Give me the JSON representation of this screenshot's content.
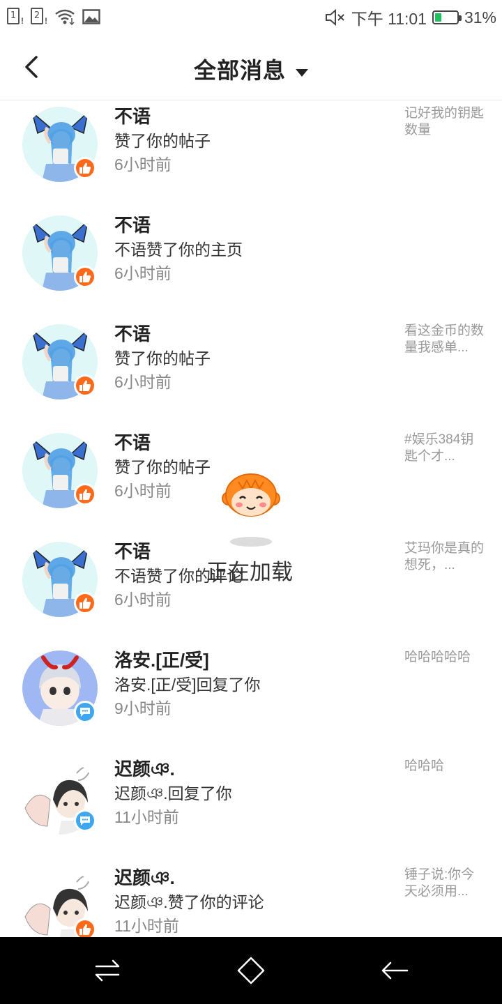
{
  "status_bar": {
    "sim1": "1",
    "sim2": "2",
    "time": "下午 11:01",
    "battery": "31%",
    "battery_level": 0.31,
    "icons": [
      "sim1-icon",
      "sim2-icon",
      "wifi-icon",
      "image-icon",
      "mute-icon",
      "battery-icon"
    ]
  },
  "header": {
    "title": "全部消息"
  },
  "messages": [
    {
      "name": "不语",
      "action": "赞了你的帖子",
      "time": "6小时前",
      "preview": "记好我的钥匙数量",
      "badge": "like"
    },
    {
      "name": "不语",
      "action": "不语赞了你的主页",
      "time": "6小时前",
      "preview": "",
      "badge": "like"
    },
    {
      "name": "不语",
      "action": "赞了你的帖子",
      "time": "6小时前",
      "preview": "看这金币的数量我感单...",
      "badge": "like"
    },
    {
      "name": "不语",
      "action": "赞了你的帖子",
      "time": "6小时前",
      "preview": "#娱乐384钥匙个才...",
      "badge": "like"
    },
    {
      "name": "不语",
      "action": "不语赞了你的评论",
      "time": "6小时前",
      "preview": " 艾玛你是真的想死，...",
      "badge": "like"
    },
    {
      "name": "洛安.[正/受]",
      "action": "洛安.[正/受]回复了你",
      "time": "9小时前",
      "preview": "哈哈哈哈哈",
      "badge": "reply"
    },
    {
      "name": "迟颜ঞ.",
      "action": "迟颜ঞ.回复了你",
      "time": "11小时前",
      "preview": "哈哈哈",
      "badge": "reply"
    },
    {
      "name": "迟颜ঞ.",
      "action": "迟颜ঞ.赞了你的评论",
      "time": "11小时前",
      "preview": "锤子说:你今天必须用...",
      "badge": "like"
    }
  ],
  "loading": {
    "text": "正在加载"
  },
  "colors": {
    "like_badge": "#ff6a1a",
    "reply_badge": "#3fa7f0",
    "battery_green": "#1fc15f",
    "nav_bar": "#000000"
  }
}
